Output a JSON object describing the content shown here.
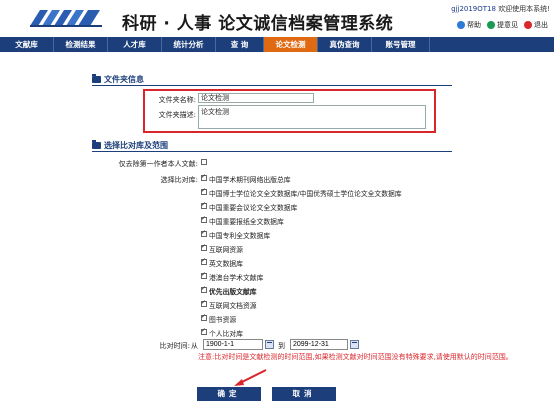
{
  "header": {
    "title": "科研 · 人事  论文诚信档案管理系统",
    "user_id": "gjj2019OT18",
    "welcome": "欢迎使用本系统!",
    "links": [
      {
        "label": "帮助",
        "icon": "help-icon",
        "color": "#2e7bd6"
      },
      {
        "label": "提意见",
        "icon": "feedback-icon",
        "color": "#1a9a55"
      },
      {
        "label": "退出",
        "icon": "exit-icon",
        "color": "#d9262b"
      }
    ]
  },
  "nav": [
    {
      "label": "文献库"
    },
    {
      "label": "检测结果"
    },
    {
      "label": "人才库"
    },
    {
      "label": "统计分析"
    },
    {
      "label": "查 询"
    },
    {
      "label": "论文检测",
      "active": true
    },
    {
      "label": "真伪查询"
    },
    {
      "label": "账号管理"
    }
  ],
  "folder_info": {
    "section_title": "文件夹信息",
    "name_label": "文件夹名称:",
    "name_value": "论文检测",
    "desc_label": "文件夹描述:",
    "desc_value": "论文检测"
  },
  "range": {
    "section_title": "选择比对库及范围",
    "first_author_label": "仅去除第一作者本人文献:",
    "compare_label": "选择比对库:",
    "databases": [
      {
        "label": "中国学术期刊网络出版总库",
        "checked": true
      },
      {
        "label": "中国博士学位论文全文数据库/中国优秀硕士学位论文全文数据库",
        "checked": true
      },
      {
        "label": "中国重要会议论文全文数据库",
        "checked": true
      },
      {
        "label": "中国重要报纸全文数据库",
        "checked": true
      },
      {
        "label": "中国专利全文数据库",
        "checked": true
      },
      {
        "label": "互联网资源",
        "checked": true
      },
      {
        "label": "英文数据库",
        "checked": true
      },
      {
        "label": "港澳台学术文献库",
        "checked": true
      },
      {
        "label": "优先出版文献库",
        "checked": true,
        "bold": true
      },
      {
        "label": "互联网文档资源",
        "checked": true
      },
      {
        "label": "图书资源",
        "checked": true
      },
      {
        "label": "个人比对库",
        "checked": true
      }
    ],
    "time_label": "比对时间:",
    "from_label": "从",
    "from_value": "1900-1-1",
    "to_label": "到",
    "to_value": "2099-12-31",
    "note": "注意:比对时间是文献检测的时间范围,如果检测文献对时间范围没有特殊要求,请使用默认的时间范围。"
  },
  "buttons": {
    "confirm": "确定",
    "cancel": "取消"
  },
  "colors": {
    "nav_bg": "#1c3e7a",
    "nav_active": "#e06a12",
    "highlight": "#d9262b",
    "note": "#d9262b"
  }
}
